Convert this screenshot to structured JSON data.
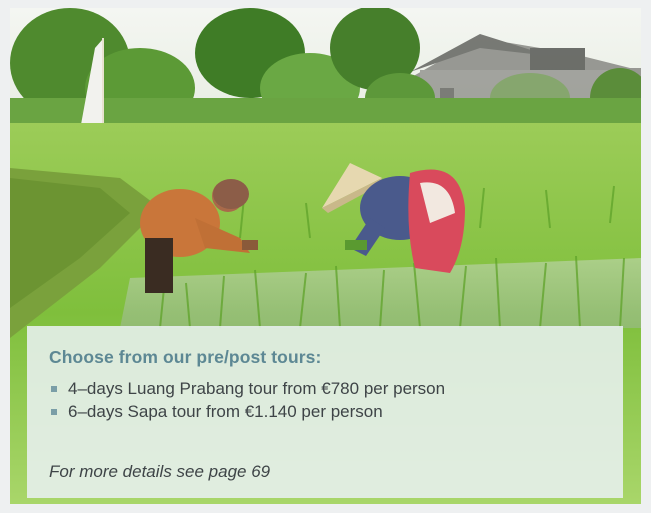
{
  "image": {
    "subject": "rice-paddy-farmers-photo"
  },
  "info_box": {
    "heading": "Choose from our pre/post tours:",
    "tours": [
      {
        "text": "4–days Luang Prabang tour from €780 per person"
      },
      {
        "text": "6–days Sapa tour from €1.140 per person"
      }
    ],
    "details": "For more details see page 69"
  },
  "colors": {
    "heading": "#5d8894",
    "bullet": "#7a9ea7",
    "body_text": "#3e4447",
    "box_background": "#e8f0f0"
  }
}
